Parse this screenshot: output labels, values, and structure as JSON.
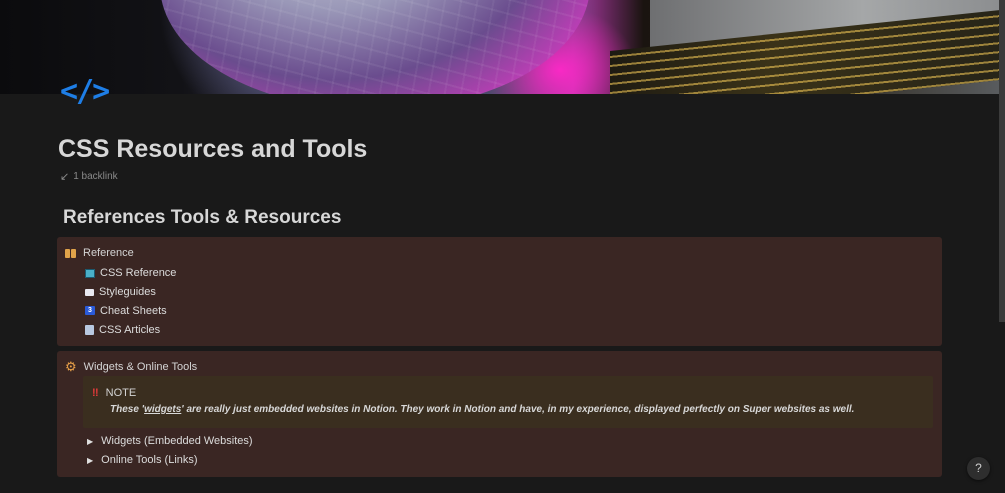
{
  "page": {
    "icon_text": "</>",
    "title": "CSS Resources and Tools",
    "backlink_arrow": "↙",
    "backlink": "1 backlink"
  },
  "section": {
    "heading": "References Tools & Resources"
  },
  "reference_callout": {
    "title": "Reference",
    "items": [
      {
        "label": "CSS Reference",
        "icon": "css-badge-icon"
      },
      {
        "label": "Styleguides",
        "icon": "book-icon"
      },
      {
        "label": "Cheat Sheets",
        "icon": "css3-icon"
      },
      {
        "label": "CSS Articles",
        "icon": "document-icon"
      }
    ]
  },
  "widgets_callout": {
    "title": "Widgets & Online Tools",
    "note": {
      "label": "NOTE",
      "bang": "‼",
      "text_before": "These '",
      "text_underlined": "widgets",
      "text_after": "' are really just embedded websites in Notion. They work in Notion and have, in my experience, displayed perfectly on Super websites as well."
    },
    "toggles": [
      {
        "label": "Widgets (Embedded Websites)"
      },
      {
        "label": "Online Tools (Links)"
      }
    ]
  },
  "help_button": "?",
  "colors": {
    "background": "#191919",
    "callout_bg": "#3a2623",
    "note_bg": "#3a2e1f",
    "icon_blue": "#1e7ee6",
    "gear_orange": "#e8a048",
    "bang_red": "#e03a3a"
  }
}
